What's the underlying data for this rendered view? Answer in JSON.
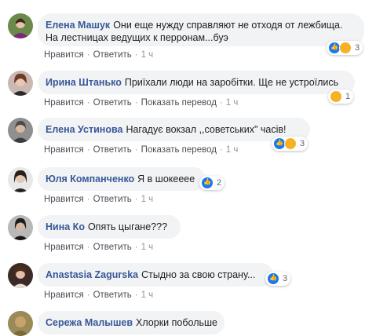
{
  "actions": {
    "like": "Нравится",
    "reply": "Ответить",
    "translate": "Показать перевод"
  },
  "comments": [
    {
      "author": "Елена Машук",
      "text_line1": "Они еще нужду справляют не отходя от лежбища.",
      "text_line2": "На лестницах ведущих к перронам...буэ",
      "time": "1 ч",
      "reactions": [
        "like-icon",
        "sad-icon"
      ],
      "count": "3"
    },
    {
      "author": "Ирина Штанько",
      "text": "Приїхали люди на заробітки. Ще не устроїлись",
      "time": "1 ч",
      "reactions": [
        "haha-icon"
      ],
      "count": "1"
    },
    {
      "author": "Елена Устинова",
      "text": "Нагадує вокзал ,,советських\" часів!",
      "time": "1 ч",
      "reactions": [
        "like-icon",
        "wow-icon"
      ],
      "count": "3"
    },
    {
      "author": "Юля Компанченко",
      "text": "Я в шокееее",
      "time": "1 ч",
      "reactions": [
        "like-icon"
      ],
      "count": "2"
    },
    {
      "author": "Нина Ко",
      "text": "Опять цыгане???",
      "time": "1 ч"
    },
    {
      "author": "Anastasia Zagurska",
      "text": "Стыдно за свою страну...",
      "time": "1 ч",
      "reactions": [
        "like-icon"
      ],
      "count": "3"
    },
    {
      "author": "Сережа Малышев",
      "text": "Хлорки побольше"
    }
  ]
}
